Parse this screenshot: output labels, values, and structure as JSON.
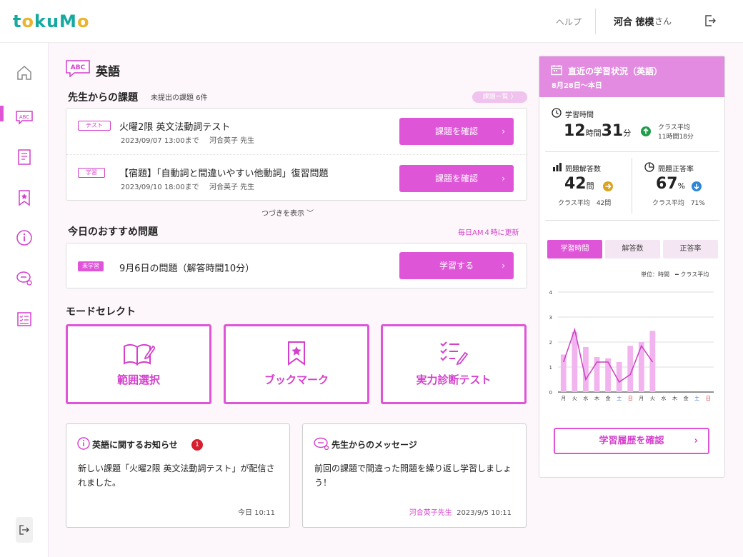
{
  "header": {
    "logo": {
      "p1": "t",
      "p2": "o",
      "p3": "k",
      "p4": "u",
      "p5": "M",
      "p6": "o"
    },
    "help": "ヘルプ",
    "user_name": "河合 徳模",
    "user_suffix": "さん"
  },
  "colors": {
    "accent": "#df55d8",
    "accent_text": "#d43fcd",
    "header_panel": "#e38be0",
    "logo_teal": "#16a9a0",
    "logo_yellow": "#ecb42a"
  },
  "sidebar": {
    "items": [
      {
        "icon": "home-icon"
      },
      {
        "icon": "abc-subject-icon",
        "active": true
      },
      {
        "icon": "notebook-icon"
      },
      {
        "icon": "bookmark-icon"
      },
      {
        "icon": "info-icon"
      },
      {
        "icon": "chat-icon"
      },
      {
        "icon": "checklist-icon"
      }
    ],
    "collapse": "‹"
  },
  "subject": {
    "badge": "ABC",
    "title": "英語"
  },
  "tasks": {
    "title": "先生からの課題",
    "unsubmitted": "未提出の課題 6件",
    "list_button": "課題一覧 〉",
    "items": [
      {
        "tag": "テスト",
        "title": "火曜2限 英文法動詞テスト",
        "deadline": "2023/09/07 13:00まで",
        "teacher": "河合英子 先生",
        "button": "課題を確認"
      },
      {
        "tag": "学習",
        "title": "【宿題】「自動詞と間違いやすい他動詞」復習問題",
        "deadline": "2023/09/10 18:00まで",
        "teacher": "河合英子 先生",
        "button": "課題を確認"
      }
    ],
    "more": "つづきを表示 ﹀"
  },
  "recommend": {
    "title": "今日のおすすめ問題",
    "update_note": "毎日AM４時に更新",
    "tag": "未学習",
    "text": "9月6日の問題（解答時間10分）",
    "button": "学習する"
  },
  "mode": {
    "title": "モードセレクト",
    "items": [
      {
        "label": "範囲選択",
        "icon": "open-book-pen-icon"
      },
      {
        "label": "ブックマーク",
        "icon": "bookmark-star-icon"
      },
      {
        "label": "実力診断テスト",
        "icon": "checklist-pen-icon"
      }
    ]
  },
  "notice": {
    "title": "英語に関するお知らせ",
    "count": "1",
    "body": "新しい課題「火曜2限 英文法動詞テスト」が配信されました。",
    "time": "今日 10:11"
  },
  "message": {
    "title": "先生からのメッセージ",
    "body": "前回の課題で間違った問題を繰り返し学習しましょう！",
    "sender": "河合英子先生",
    "time": "2023/9/5 10:11"
  },
  "panel": {
    "title": "直近の学習状況（英語）",
    "period": "8月28日～本日",
    "study_time": {
      "label": "学習時間",
      "hours": "12",
      "hours_unit": "時間",
      "minutes": "31",
      "minutes_unit": "分",
      "avg_label": "クラス平均",
      "avg": "11時間18分"
    },
    "solved": {
      "label": "問題解答数",
      "value": "42",
      "unit": "問",
      "avg": "クラス平均　42問"
    },
    "accuracy": {
      "label": "問題正答率",
      "value": "67",
      "unit": "%",
      "avg": "クラス平均　71%"
    },
    "tabs": [
      "学習時間",
      "解答数",
      "正答率"
    ],
    "legend": "単位：時間　━ クラス平均",
    "history_button": "学習履歴を確認"
  },
  "chart_data": {
    "type": "bar",
    "categories": [
      "月",
      "火",
      "水",
      "木",
      "金",
      "土",
      "日",
      "月",
      "火",
      "水",
      "木",
      "金",
      "土",
      "日"
    ],
    "series": [
      {
        "name": "",
        "type": "bar",
        "values": [
          1.5,
          2.4,
          1.8,
          1.4,
          1.35,
          1.2,
          1.85,
          2.0,
          2.45,
          0,
          0,
          0,
          0,
          0
        ]
      },
      {
        "name": "クラス平均",
        "type": "line",
        "values": [
          1.2,
          2.5,
          0.5,
          1.2,
          1.2,
          0.4,
          0.7,
          1.85,
          1.2,
          null,
          null,
          null,
          null,
          null
        ]
      }
    ],
    "yticks": [
      "0",
      "1",
      "2",
      "3",
      "4"
    ],
    "ylim": [
      0,
      4
    ],
    "unit": "単位：時間",
    "weekday_colors": {
      "土": "#2b6fd6",
      "日": "#d61f2f"
    }
  }
}
